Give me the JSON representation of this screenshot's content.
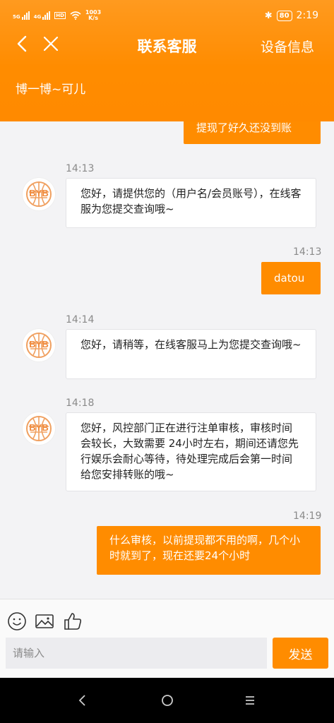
{
  "status_bar": {
    "net1": "5G",
    "net2": "4G",
    "hd": "HD",
    "speed_value": "1003",
    "speed_unit": "K/s",
    "bluetooth": "✱",
    "battery": "80",
    "time": "2:19"
  },
  "navbar": {
    "title": "联系客服",
    "device_info": "设备信息"
  },
  "agent_name": "博一博~可儿",
  "messages": [
    {
      "type": "out",
      "text": "提现了好久还没到账"
    },
    {
      "type": "time",
      "text": "14:13"
    },
    {
      "type": "in",
      "text": "您好，请提供您的（用户名/会员账号），在线客服为您提交查询哦~"
    },
    {
      "type": "time",
      "text": "14:13"
    },
    {
      "type": "out",
      "text": "datou"
    },
    {
      "type": "time",
      "text": "14:14"
    },
    {
      "type": "in",
      "text": "您好，请稍等，在线客服马上为您提交查询哦~"
    },
    {
      "type": "time",
      "text": "14:18"
    },
    {
      "type": "in",
      "text": "您好，风控部门正在进行注单审核，审核时间会较长，大致需要 24小时左右，期间还请您先行娱乐会耐心等待，待处理完成后会第一时间给您安排转账的哦~"
    },
    {
      "type": "time",
      "text": "14:19"
    },
    {
      "type": "out",
      "text": "什么审核，以前提现都不用的啊，几个小时就到了，现在还要24个小时"
    }
  ],
  "input": {
    "placeholder": "请输入",
    "send_label": "发送"
  },
  "colors": {
    "accent": "#ff8c00",
    "avatar_logo": "#f0a060"
  }
}
